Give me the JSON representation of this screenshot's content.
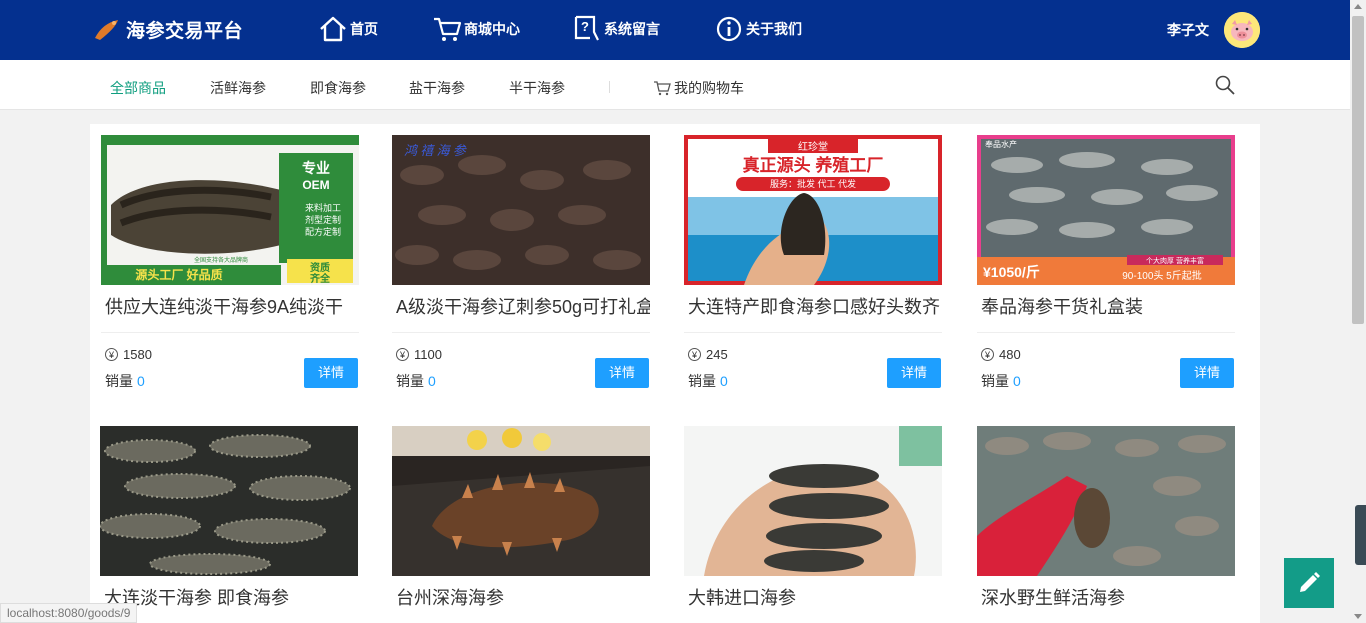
{
  "header": {
    "logo_text": "海参交易平台",
    "nav": [
      {
        "label": "首页",
        "icon": "home-icon"
      },
      {
        "label": "商城中心",
        "icon": "cart-icon"
      },
      {
        "label": "系统留言",
        "icon": "message-icon"
      },
      {
        "label": "关于我们",
        "icon": "info-icon"
      }
    ],
    "username": "李子文"
  },
  "categories": [
    "全部商品",
    "活鲜海参",
    "即食海参",
    "盐干海参",
    "半干海参"
  ],
  "active_category": 0,
  "cart_label": "我的购物车",
  "products": [
    {
      "name": "供应大连纯淡干海参9A纯淡干",
      "price": "1580",
      "sales_label": "销量",
      "sales": "0",
      "button": "详情",
      "image_text": [
        "专业",
        "OEM",
        "来料加工",
        "剂型定制",
        "配方定制",
        "资质",
        "齐全",
        "源头工厂 好品质",
        "全国支持各大品牌商"
      ]
    },
    {
      "name": "A级淡干海参辽刺参50g可打礼盒",
      "price": "1100",
      "sales_label": "销量",
      "sales": "0",
      "button": "详情",
      "image_text": [
        "鸿 禧 海 参"
      ]
    },
    {
      "name": "大连特产即食海参口感好头数齐",
      "price": "245",
      "sales_label": "销量",
      "sales": "0",
      "button": "详情",
      "image_text": [
        "红珍堂",
        "真正源头 养殖工厂",
        "服务：批发 代工 代发"
      ]
    },
    {
      "name": "奉品海参干货礼盒装",
      "price": "480",
      "sales_label": "销量",
      "sales": "0",
      "button": "详情",
      "image_text": [
        "奉品水产",
        "¥1050/斤",
        "个大肉厚 营养丰富",
        "90-100头 5斤起批"
      ]
    },
    {
      "name": "大连淡干海参 即食海参",
      "image_text": []
    },
    {
      "name": "台州深海海参",
      "image_text": []
    },
    {
      "name": "大韩进口海参",
      "image_text": []
    },
    {
      "name": "深水野生鲜活海参",
      "image_text": []
    }
  ],
  "status_url": "localhost:8080/goods/9",
  "colors": {
    "header_bg": "#04308f",
    "accent_green": "#0f9e7f",
    "button_blue": "#1e9fff",
    "fab": "#139c88"
  }
}
